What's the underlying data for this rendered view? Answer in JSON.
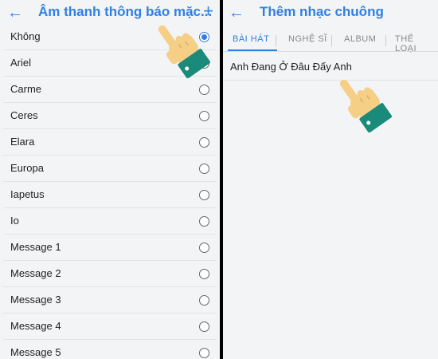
{
  "left_screen": {
    "title": "Âm thanh thông báo mặc...",
    "back_icon": "arrow-left-icon",
    "add_icon": "plus-icon",
    "items": [
      {
        "label": "Không",
        "selected": true
      },
      {
        "label": "Ariel",
        "selected": false
      },
      {
        "label": "Carme",
        "selected": false
      },
      {
        "label": "Ceres",
        "selected": false
      },
      {
        "label": "Elara",
        "selected": false
      },
      {
        "label": "Europa",
        "selected": false
      },
      {
        "label": "Iapetus",
        "selected": false
      },
      {
        "label": "Io",
        "selected": false
      },
      {
        "label": "Message 1",
        "selected": false
      },
      {
        "label": "Message 2",
        "selected": false
      },
      {
        "label": "Message 3",
        "selected": false
      },
      {
        "label": "Message 4",
        "selected": false
      },
      {
        "label": "Message 5",
        "selected": false
      }
    ]
  },
  "right_screen": {
    "title": "Thêm nhạc chuông",
    "back_icon": "arrow-left-icon",
    "tabs": [
      {
        "label": "BÀI HÁT",
        "active": true
      },
      {
        "label": "NGHỆ SĨ",
        "active": false
      },
      {
        "label": "ALBUM",
        "active": false
      },
      {
        "label": "THỂ LOẠI",
        "active": false
      }
    ],
    "songs": [
      "Anh Đang Ở Đâu Đấy Anh"
    ]
  },
  "colors": {
    "accent": "#2f80e6",
    "background": "#f3f4f6",
    "hand_skin": "#f6cf86",
    "hand_cuff": "#1a8a7a"
  },
  "overlay_icons": [
    "pointing-hand-icon",
    "pointing-hand-icon"
  ]
}
